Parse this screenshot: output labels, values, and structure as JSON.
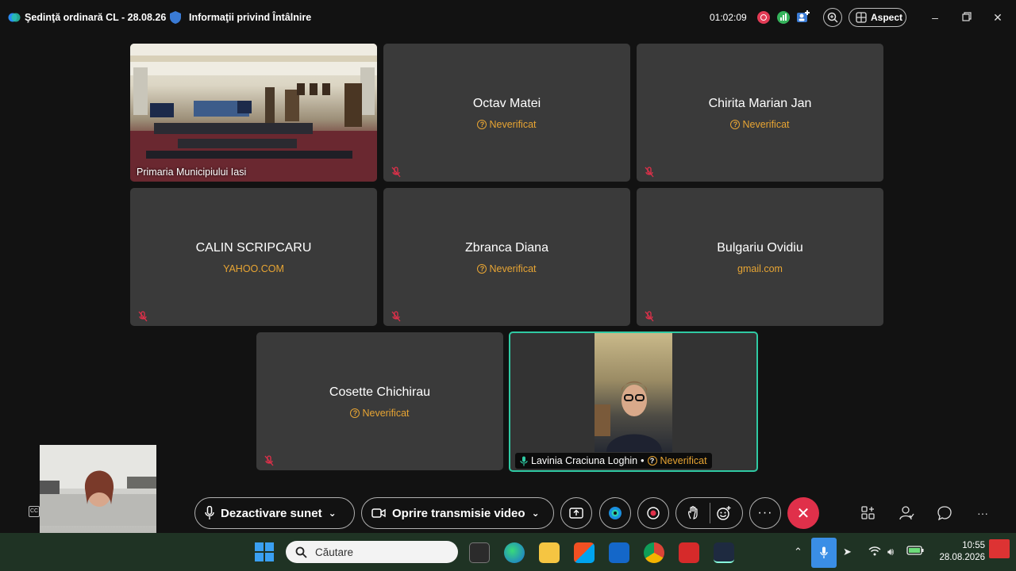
{
  "titlebar": {
    "meeting_title": "Şedinţă ordinară CL - 28.08.26",
    "info_label": "Informaţii privind Întâlnire",
    "elapsed_time": "01:02:09",
    "layout_label": "Aspect"
  },
  "tiles": [
    {
      "name": "Primaria Municipiului Iasi",
      "status": "",
      "type": "video"
    },
    {
      "name": "Octav Matei",
      "status": "Neverificat",
      "type": "avatar"
    },
    {
      "name": "Chirita Marian Jan",
      "status": "Neverificat",
      "type": "avatar"
    },
    {
      "name": "CALIN SCRIPCARU",
      "status": "YAHOO.COM",
      "type": "avatar"
    },
    {
      "name": "Zbranca Diana",
      "status": "Neverificat",
      "type": "avatar"
    },
    {
      "name": "Bulgariu Ovidiu",
      "status": "gmail.com",
      "type": "avatar"
    },
    {
      "name": "Cosette Chichirau",
      "status": "Neverificat",
      "type": "avatar"
    },
    {
      "name": "Lavinia Craciuna Loghin",
      "status": "Neverificat",
      "type": "active-speaker"
    }
  ],
  "controls": {
    "mute_label": "Dezactivare sunet",
    "video_label": "Oprire transmisie video"
  },
  "taskbar": {
    "search_placeholder": "Căutare",
    "time": "10:55",
    "date": "28.08.2026"
  },
  "colors": {
    "background": "#121212",
    "tile": "#3a3a3a",
    "unverified": "#e8a533",
    "active_border": "#2fc9a3",
    "leave": "#e0304a",
    "taskbar": "#1f3324"
  }
}
